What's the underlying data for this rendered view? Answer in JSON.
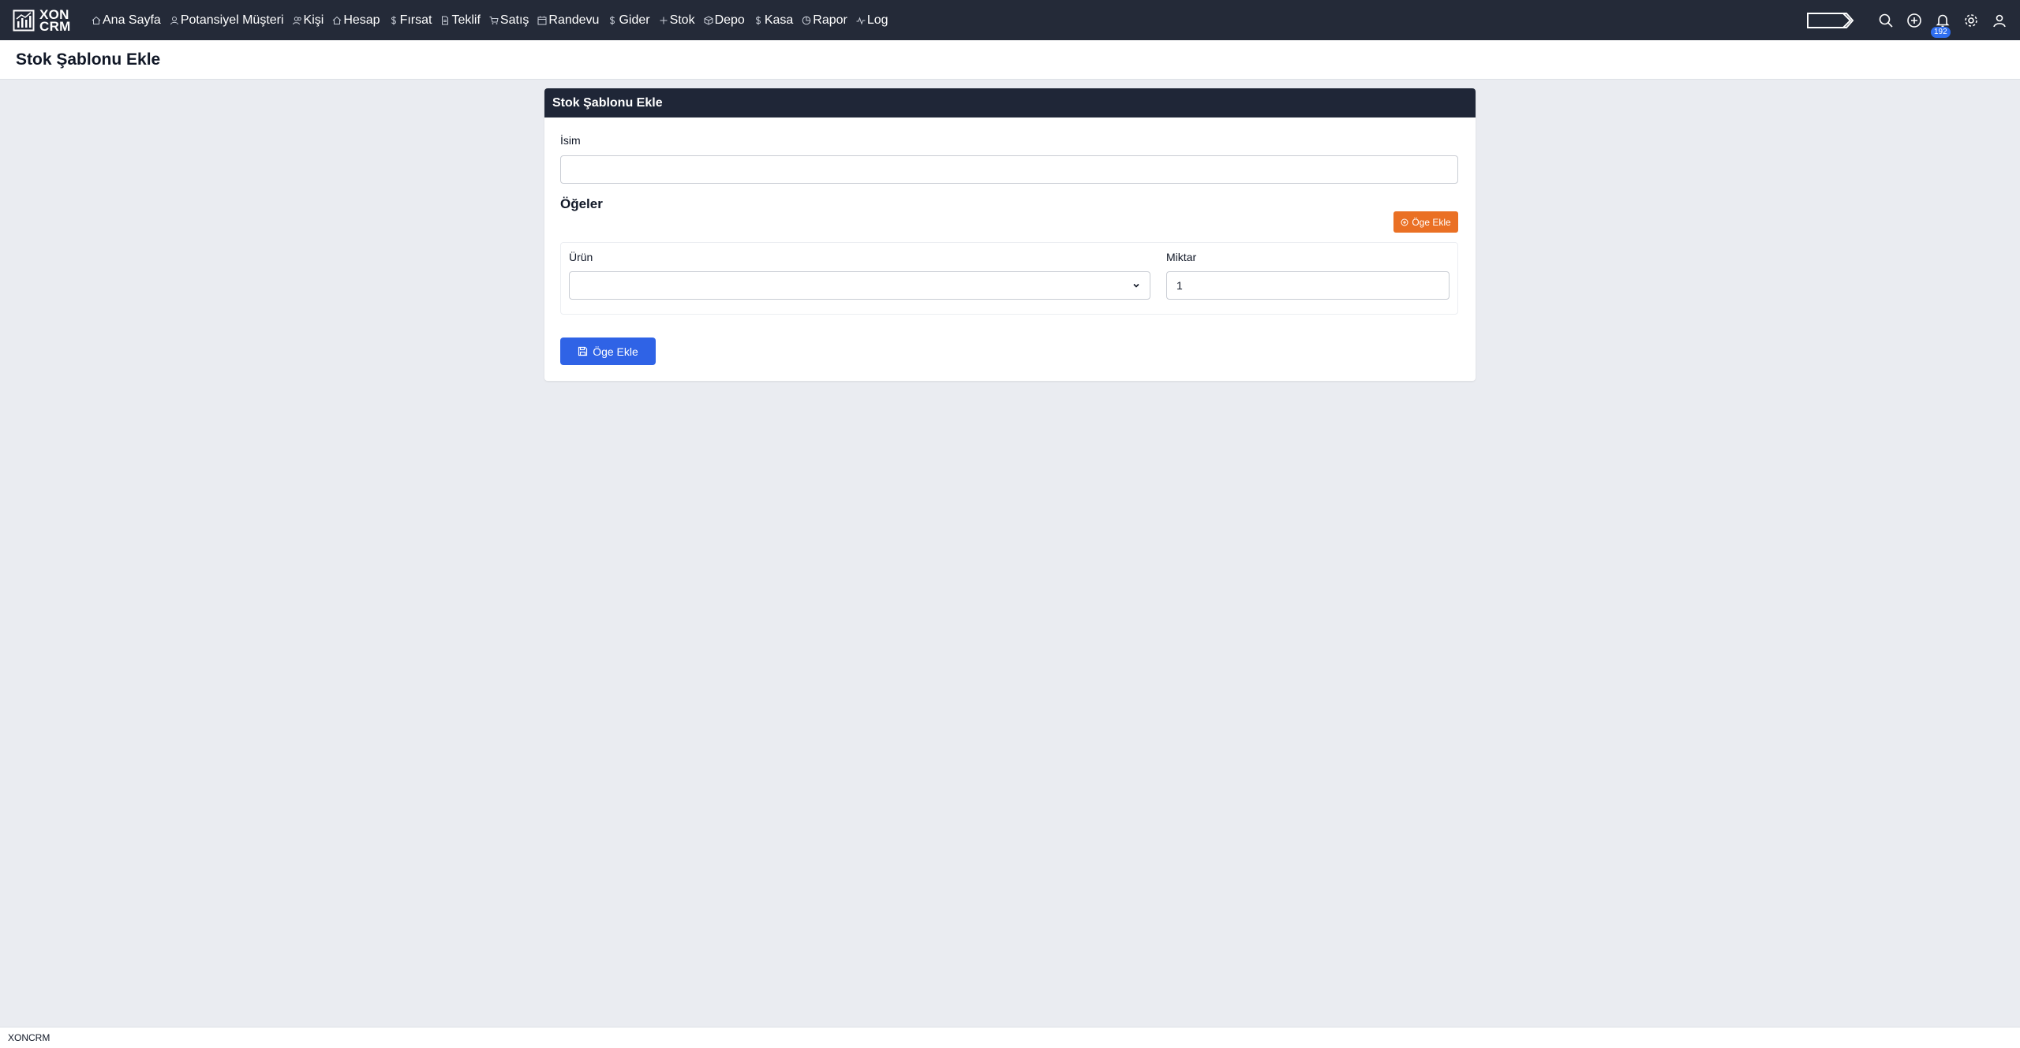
{
  "brand": {
    "line1": "XON",
    "line2": "CRM"
  },
  "nav": {
    "items": [
      {
        "label": "Ana Sayfa",
        "icon": "home-icon"
      },
      {
        "label": "Potansiyel Müşteri",
        "icon": "user-icon"
      },
      {
        "label": "Kişi",
        "icon": "users-icon"
      },
      {
        "label": "Hesap",
        "icon": "home-icon"
      },
      {
        "label": "Fırsat",
        "icon": "dollar-icon"
      },
      {
        "label": "Teklif",
        "icon": "file-icon"
      },
      {
        "label": "Satış",
        "icon": "cart-icon"
      },
      {
        "label": "Randevu",
        "icon": "calendar-icon"
      },
      {
        "label": "Gider",
        "icon": "dollar-icon"
      },
      {
        "label": "Stok",
        "icon": "plus-icon"
      },
      {
        "label": "Depo",
        "icon": "box-icon"
      },
      {
        "label": "Kasa",
        "icon": "dollar-icon"
      },
      {
        "label": "Rapor",
        "icon": "pie-icon"
      },
      {
        "label": "Log",
        "icon": "activity-icon"
      }
    ],
    "notification_count": "192"
  },
  "page": {
    "title": "Stok Şablonu Ekle"
  },
  "card": {
    "title": "Stok Şablonu Ekle",
    "name_label": "İsim",
    "name_value": "",
    "items_title": "Öğeler",
    "add_item_small": "Öge Ekle",
    "product_label": "Ürün",
    "product_value": "",
    "quantity_label": "Miktar",
    "quantity_value": "1",
    "submit_label": "Öge Ekle"
  },
  "footer": {
    "text": "XONCRM"
  },
  "colors": {
    "navbar": "#242a38",
    "card_header": "#1f2637",
    "orange": "#ea7024",
    "blue": "#2f63e6",
    "badge": "#2f6ef0"
  }
}
